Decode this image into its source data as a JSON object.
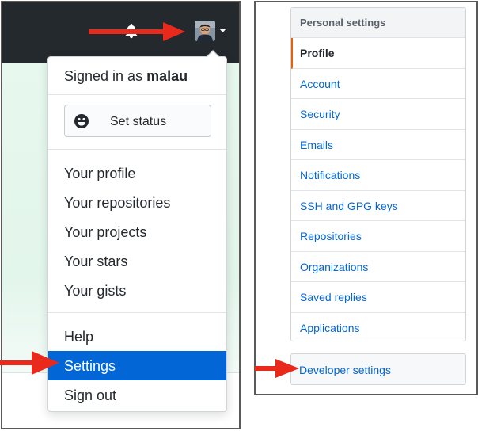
{
  "header": {
    "icons": [
      "bell-icon",
      "plus-icon",
      "avatar",
      "caret-down-icon"
    ]
  },
  "dropdown": {
    "signed_in_prefix": "Signed in as ",
    "username": "malau",
    "set_status": "Set status",
    "profile_items": [
      "Your profile",
      "Your repositories",
      "Your projects",
      "Your stars",
      "Your gists"
    ],
    "help": "Help",
    "settings": "Settings",
    "sign_out": "Sign out",
    "selected_item": "Settings"
  },
  "settings_menu": {
    "header": "Personal settings",
    "items": [
      "Profile",
      "Account",
      "Security",
      "Emails",
      "Notifications",
      "SSH and GPG keys",
      "Repositories",
      "Organizations",
      "Saved replies",
      "Applications"
    ],
    "selected_item": "Profile",
    "developer_settings": "Developer settings"
  },
  "colors": {
    "topbar": "#24292e",
    "link": "#0366d6",
    "highlight": "#0366d6",
    "selected_indicator": "#e36209",
    "arrow": "#e8291c",
    "page_tint": "#e6f7ed"
  },
  "annotations": {
    "arrow_icon": "red-arrow-icon"
  }
}
